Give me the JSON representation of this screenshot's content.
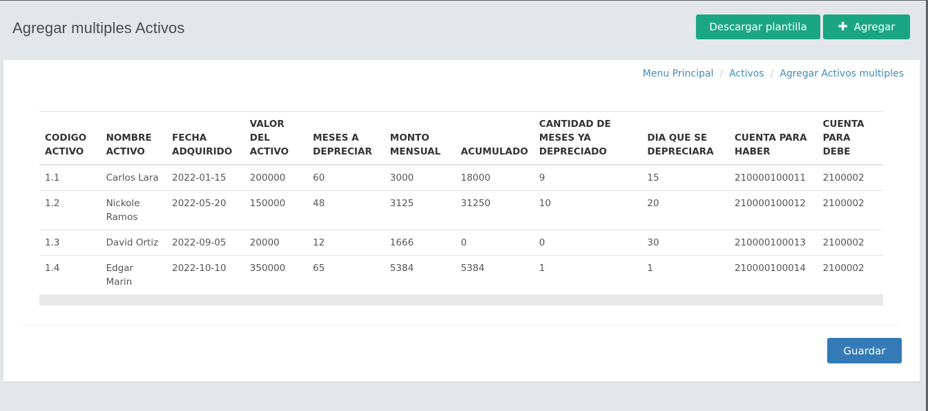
{
  "header": {
    "title": "Agregar multiples Activos",
    "download_label": "Descargar plantilla",
    "add_label": "Agregar",
    "add_icon": "plus-icon"
  },
  "breadcrumb": [
    "Menu Principal",
    "Activos",
    "Agregar Activos multiples"
  ],
  "table": {
    "headers": [
      [
        "CODIGO",
        "ACTIVO"
      ],
      [
        "NOMBRE",
        "ACTIVO"
      ],
      [
        "FECHA",
        "ADQUIRIDO"
      ],
      [
        "VALOR DEL",
        "ACTIVO"
      ],
      [
        "MESES A",
        "DEPRECIAR"
      ],
      [
        "MONTO",
        "MENSUAL"
      ],
      [
        "ACUMULADO"
      ],
      [
        "CANTIDAD DE",
        "MESES YA",
        "DEPRECIADO"
      ],
      [
        "DIA QUE SE",
        "DEPRECIARA"
      ],
      [
        "CUENTA PARA",
        "HABER"
      ],
      [
        "CUENTA",
        "PARA DEBE"
      ]
    ],
    "rows": [
      [
        "1.1",
        "Carlos Lara",
        "2022-01-15",
        "200000",
        "60",
        "3000",
        "18000",
        "9",
        "15",
        "210000100011",
        "2100002"
      ],
      [
        "1.2",
        "Nickole Ramos",
        "2022-05-20",
        "150000",
        "48",
        "3125",
        "31250",
        "10",
        "20",
        "210000100012",
        "2100002"
      ],
      [
        "1.3",
        "David Ortiz",
        "2022-09-05",
        "20000",
        "12",
        "1666",
        "0",
        "0",
        "30",
        "210000100013",
        "2100002"
      ],
      [
        "1.4",
        "Edgar Marin",
        "2022-10-10",
        "350000",
        "65",
        "5384",
        "5384",
        "1",
        "1",
        "210000100014",
        "2100002"
      ]
    ]
  },
  "footer": {
    "save_label": "Guardar"
  },
  "colors": {
    "primary_green": "#1aa683",
    "primary_blue": "#337ab7",
    "link": "#3c8dbc"
  }
}
